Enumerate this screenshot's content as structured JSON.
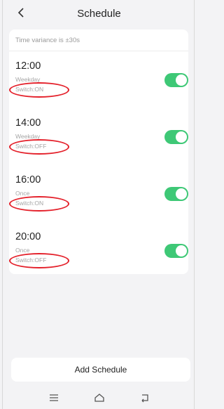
{
  "header": {
    "title": "Schedule"
  },
  "variance_note": "Time variance is ±30s",
  "schedules": [
    {
      "time": "12:00",
      "repeat": "Weekday",
      "switch_state": "Switch:ON",
      "enabled": true
    },
    {
      "time": "14:00",
      "repeat": "Weekday",
      "switch_state": "Switch:OFF",
      "enabled": true
    },
    {
      "time": "16:00",
      "repeat": "Once",
      "switch_state": "Switch:ON",
      "enabled": true
    },
    {
      "time": "20:00",
      "repeat": "Once",
      "switch_state": "Switch:OFF",
      "enabled": true
    }
  ],
  "add_button_label": "Add Schedule",
  "colors": {
    "toggle_on": "#3ec876",
    "annotation": "#e4202a"
  },
  "icons": {
    "back": "chevron-left-icon",
    "nav": [
      "menu-icon",
      "home-icon",
      "return-icon"
    ]
  }
}
